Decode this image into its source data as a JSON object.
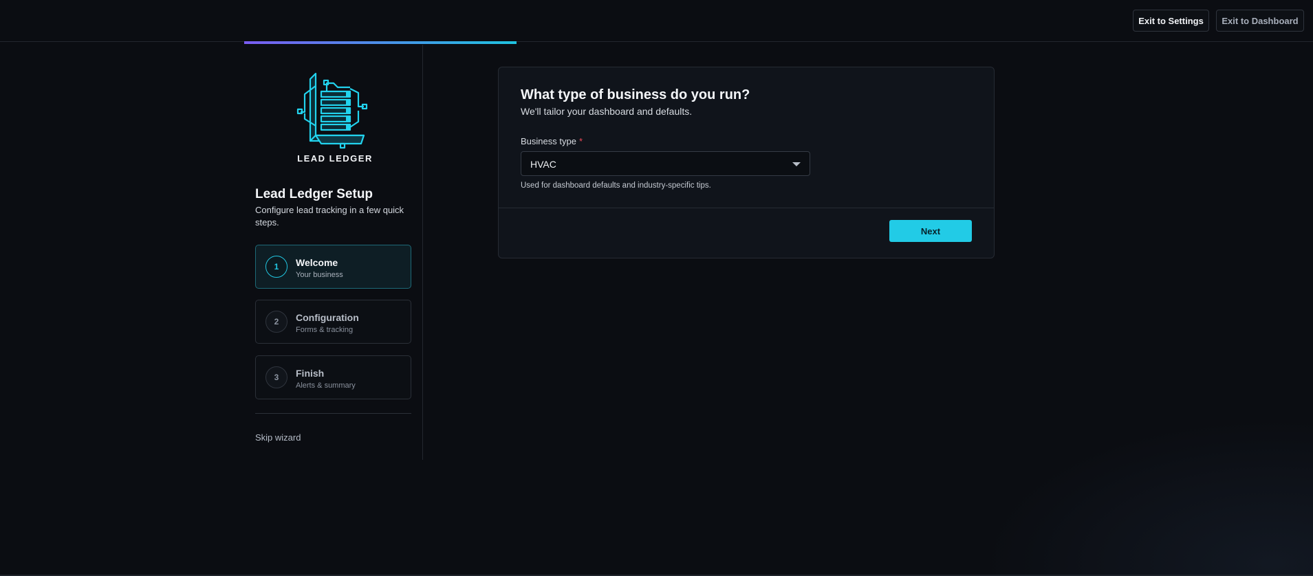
{
  "header": {
    "exit_settings": "Exit to Settings",
    "exit_dashboard": "Exit to Dashboard"
  },
  "progress": {
    "fraction": 0.33
  },
  "sidebar": {
    "logo_text": "LEAD LEDGER",
    "title": "Lead Ledger Setup",
    "subtitle": "Configure lead tracking in a few quick steps.",
    "steps": [
      {
        "num": "1",
        "title": "Welcome",
        "sub": "Your business",
        "active": true
      },
      {
        "num": "2",
        "title": "Configuration",
        "sub": "Forms & tracking",
        "active": false
      },
      {
        "num": "3",
        "title": "Finish",
        "sub": "Alerts & summary",
        "active": false
      }
    ],
    "skip": "Skip wizard"
  },
  "card": {
    "title": "What type of business do you run?",
    "subtitle": "We'll tailor your dashboard and defaults.",
    "field_label": "Business type",
    "required_mark": "*",
    "select_value": "HVAC",
    "help": "Used for dashboard defaults and industry-specific tips.",
    "next": "Next"
  },
  "colors": {
    "accent": "#22cbe6",
    "background": "#0b0d12",
    "required": "#ef4a5a"
  }
}
